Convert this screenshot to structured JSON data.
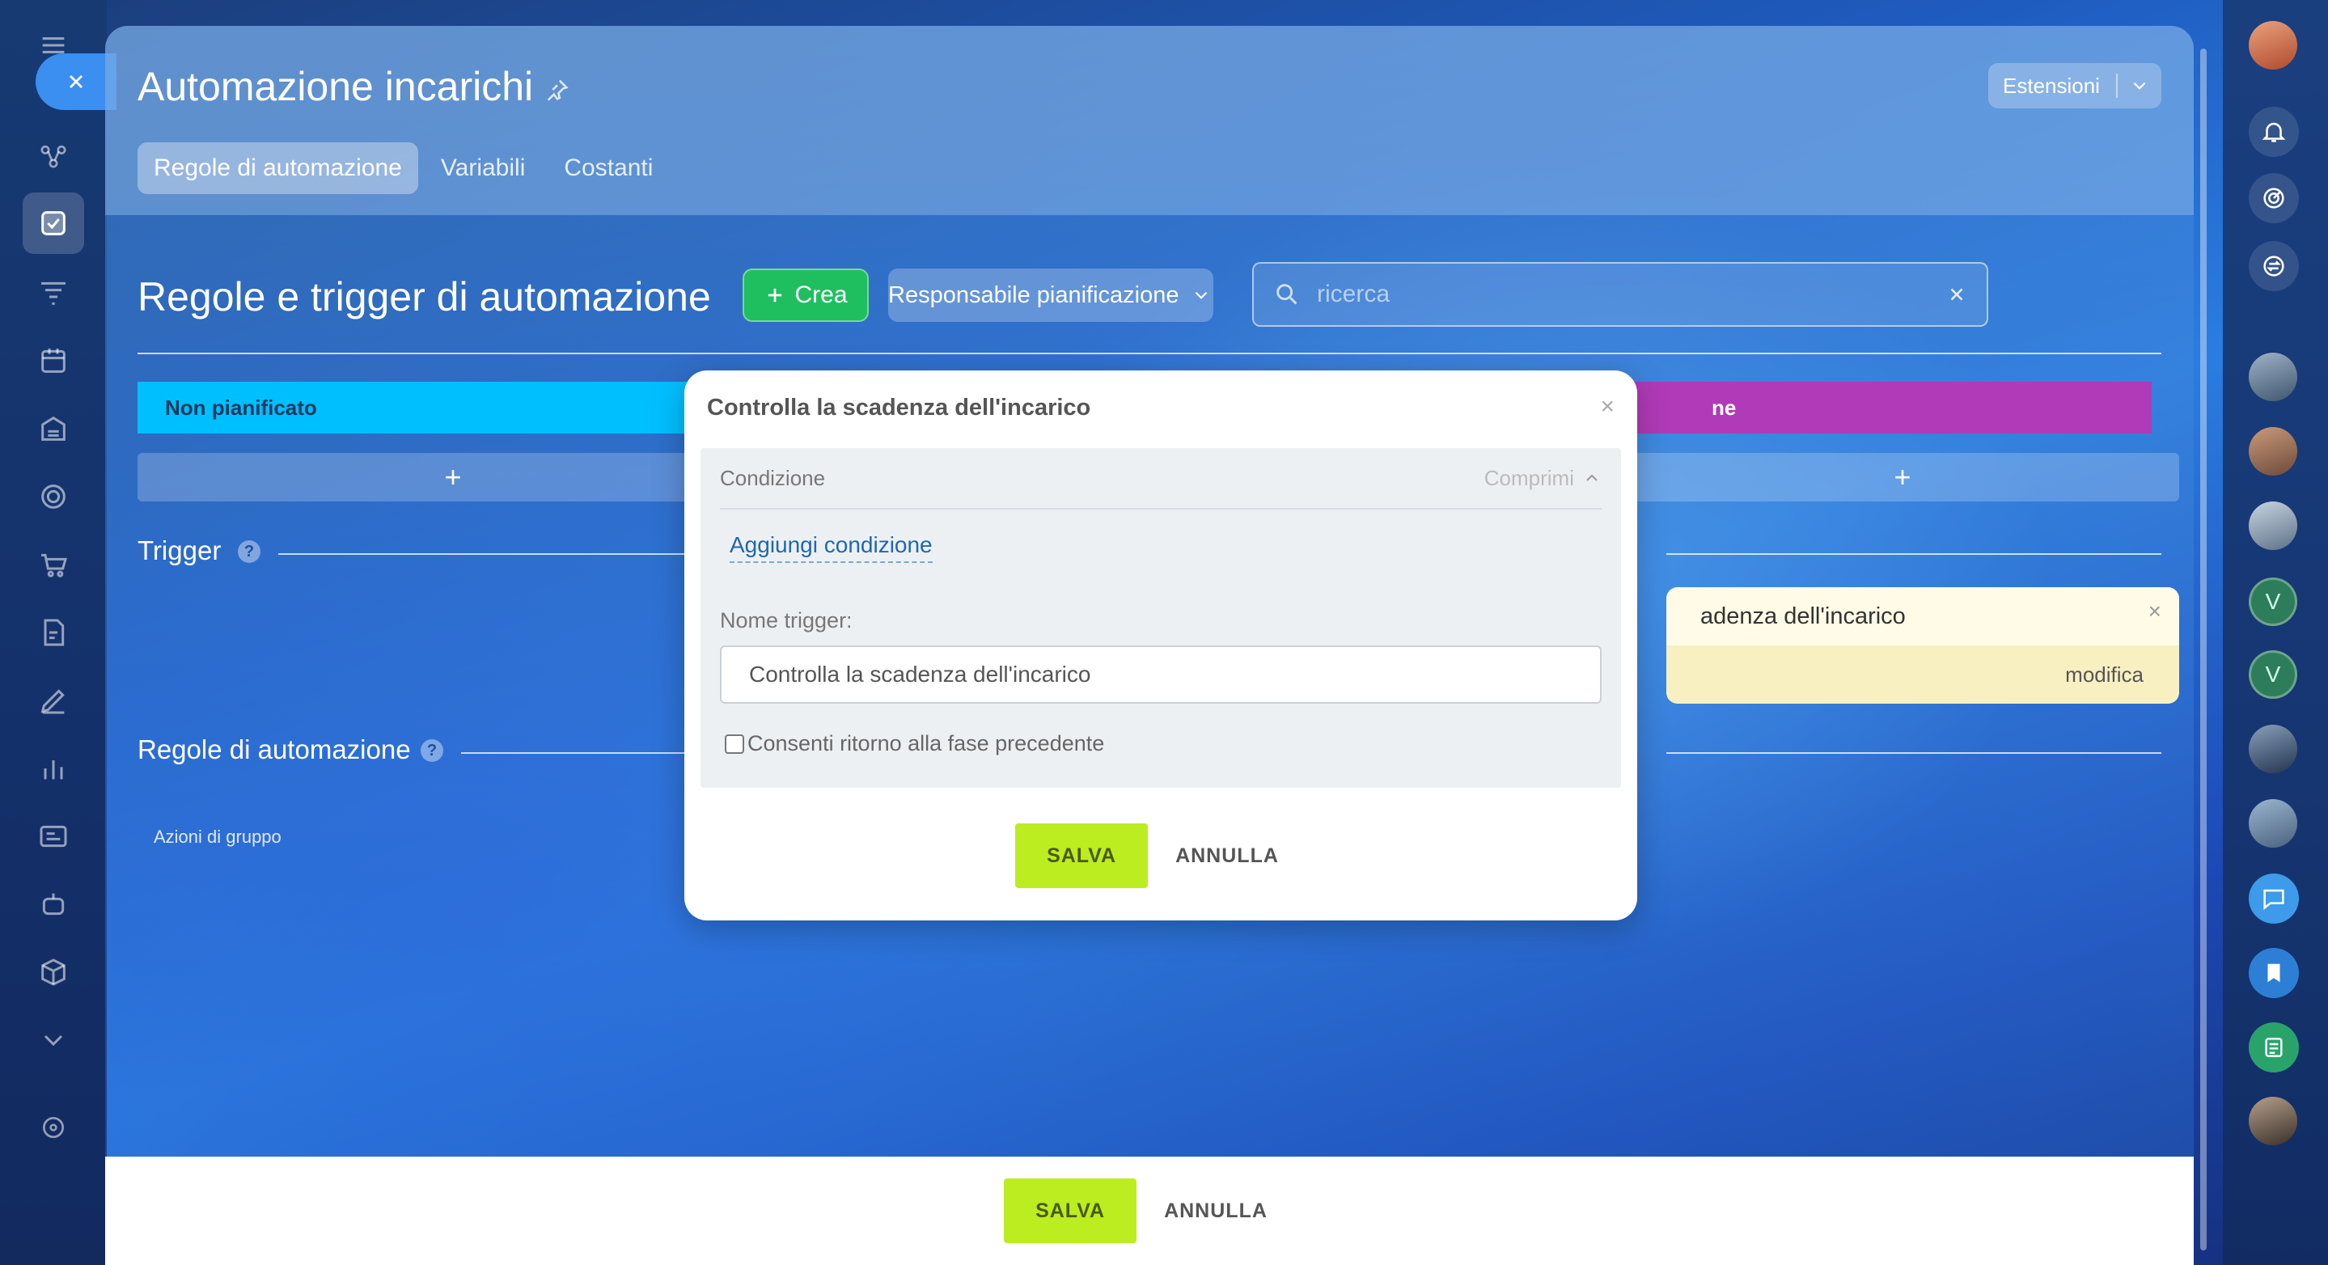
{
  "page": {
    "title": "Automazione incarichi",
    "extensions_label": "Estensioni"
  },
  "tabs": [
    {
      "label": "Regole di automazione",
      "active": true
    },
    {
      "label": "Variabili",
      "active": false
    },
    {
      "label": "Costanti",
      "active": false
    }
  ],
  "toolbar": {
    "section_title": "Regole e trigger di automazione",
    "create_label": "Crea",
    "responsible_label": "Responsabile pianificazione",
    "search_placeholder": "ricerca"
  },
  "stages": [
    {
      "name": "Non pianificato",
      "color": "#00bfff"
    },
    {
      "name": "ne",
      "color": "#b03ab8"
    }
  ],
  "sections": {
    "trigger": "Trigger",
    "rules": "Regole di automazione",
    "group_actions": "Azioni di gruppo"
  },
  "trigger_card": {
    "text": "adenza dell'incarico",
    "edit_label": "modifica"
  },
  "modal": {
    "title": "Controlla la scadenza dell'incarico",
    "condition_label": "Condizione",
    "collapse_label": "Comprimi",
    "add_condition": "Aggiungi condizione",
    "name_label": "Nome trigger:",
    "name_value": "Controlla la scadenza dell'incarico",
    "checkbox_label": "Consenti ritorno alla fase precedente",
    "checkbox_checked": false,
    "save_label": "SALVA",
    "cancel_label": "ANNULLA"
  },
  "footer": {
    "save_label": "SALVA",
    "cancel_label": "ANNULLA"
  },
  "right_rail": {
    "avatar_letters": [
      "V",
      "V"
    ]
  },
  "colors": {
    "accent_green": "#1fbf5f",
    "save_green": "#bbed21",
    "link_blue": "#2067b0"
  }
}
